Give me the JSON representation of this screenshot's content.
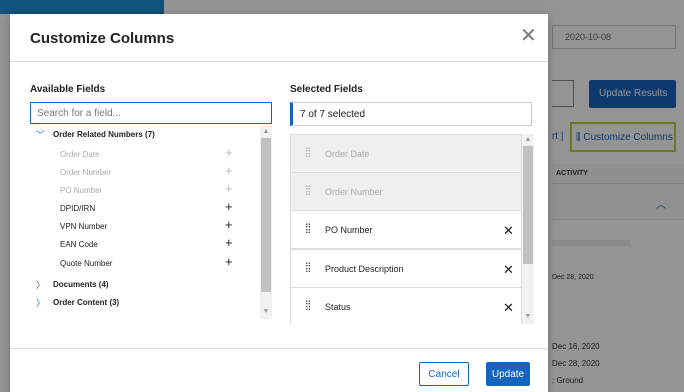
{
  "background": {
    "date_value": "2020-10-08",
    "update_results_label": "Update Results",
    "export_fragment": "rt |",
    "customize_columns_link": "Customize Columns",
    "activity_header": "ACTIVITY",
    "row_date": "Dec 28, 2020",
    "line_1": "Dec 16, 2020",
    "line_2": "Dec 28, 2020",
    "line_3": ": Ground"
  },
  "modal": {
    "title": "Customize Columns",
    "available": {
      "heading": "Available Fields",
      "search_placeholder": "Search for a field...",
      "groups": [
        {
          "label": "Order Related Numbers (7)",
          "expanded": true,
          "fields": [
            {
              "label": "Order Date",
              "enabled": false
            },
            {
              "label": "Order Number",
              "enabled": false
            },
            {
              "label": "PO Number",
              "enabled": false
            },
            {
              "label": "DPID/IRN",
              "enabled": true
            },
            {
              "label": "VPN Number",
              "enabled": true
            },
            {
              "label": "EAN Code",
              "enabled": true
            },
            {
              "label": "Quote Number",
              "enabled": true
            }
          ]
        },
        {
          "label": "Documents (4)",
          "expanded": false
        },
        {
          "label": "Order Content (3)",
          "expanded": false
        }
      ]
    },
    "selected": {
      "heading": "Selected Fields",
      "count_text": "7 of 7 selected",
      "items": [
        {
          "label": "Order Date",
          "removable": false
        },
        {
          "label": "Order Number",
          "removable": false
        },
        {
          "label": "PO Number",
          "removable": true
        },
        {
          "label": "Product Description",
          "removable": true
        },
        {
          "label": "Status",
          "removable": true
        }
      ]
    },
    "cancel_label": "Cancel",
    "update_label": "Update"
  },
  "icons": {
    "close": "close-icon",
    "expanded": "chevron-down-icon",
    "collapsed": "chevron-right-icon",
    "add": "plus-icon",
    "remove": "remove-icon",
    "drag": "drag-handle-icon",
    "customize": "columns-icon"
  },
  "colors": {
    "accent": "#1565c0",
    "highlight": "#b5d334",
    "disabled_text": "#aaaaaa"
  }
}
